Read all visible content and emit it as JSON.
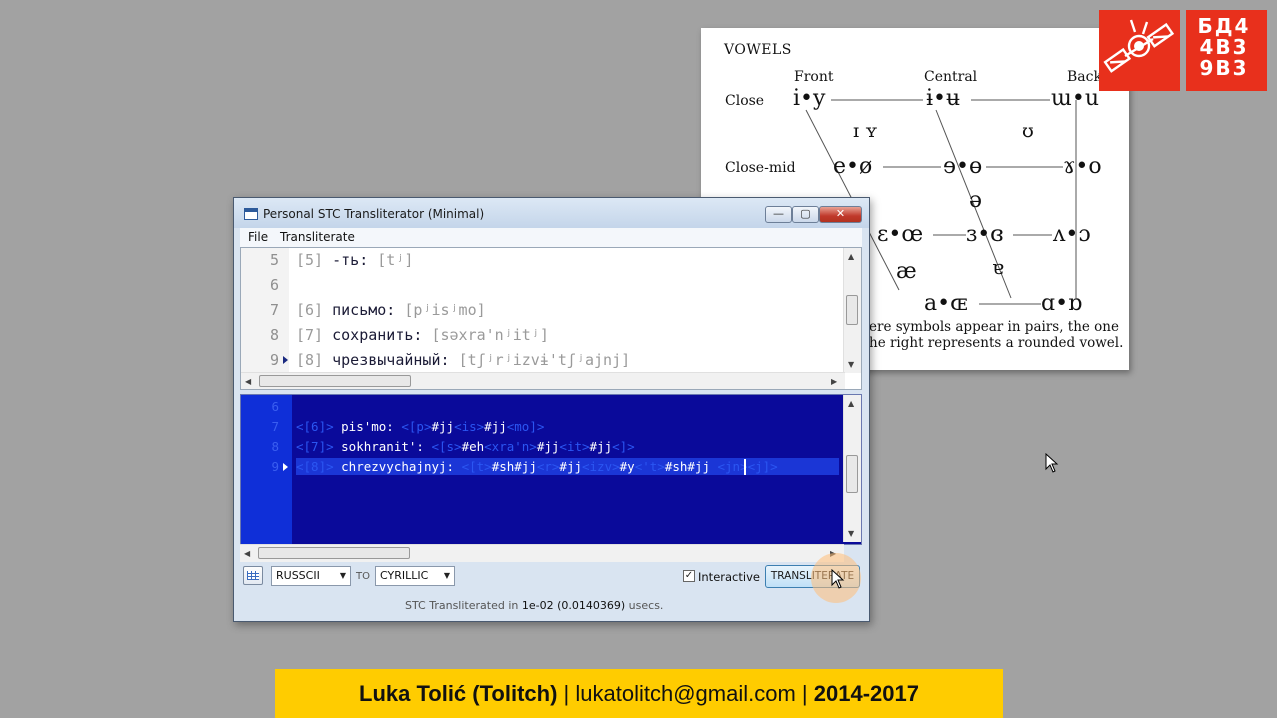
{
  "ipa_chart": {
    "heading": "VOWELS",
    "columns": {
      "front": "Front",
      "central": "Central",
      "back": "Back"
    },
    "rows": {
      "close": "Close",
      "close_mid": "Close-mid"
    },
    "symbols": {
      "close_front": "i•y",
      "close_central": "ɨ•ʉ",
      "close_back": "ɯ•u",
      "near_close_front": "ɪ ʏ",
      "near_close_back": "ʊ",
      "close_mid_front": "e•ø",
      "close_mid_central": "ɘ•ɵ",
      "close_mid_back": "ɤ•o",
      "mid_central": "ə",
      "open_mid_front": "ɛ•œ",
      "open_mid_central": "ɜ•ɞ",
      "open_mid_back": "ʌ•ɔ",
      "near_open_front": "æ",
      "near_open_central": "ɐ",
      "open_front": "a•ɶ",
      "open_back": "ɑ•ɒ"
    },
    "note_line1": "ere symbols appear in pairs, the one",
    "note_line2": "he right represents a rounded vowel."
  },
  "logo": {
    "glyphs_line1": "БД4",
    "glyphs_line2": "4В3",
    "glyphs_line3": "9В3",
    "color": "#e8301c"
  },
  "window": {
    "title": "Personal STC Transliterator (Minimal)",
    "controls": {
      "minimize": "—",
      "maximize": "▢",
      "close": "✕"
    },
    "menu": {
      "file": "File",
      "transliterate": "Transliterate"
    },
    "input_lines": [
      {
        "num": "5",
        "tag": "[5]",
        "word": "-ть:",
        "ipa": "[tʲ]"
      },
      {
        "num": "6",
        "tag": "",
        "word": "",
        "ipa": ""
      },
      {
        "num": "7",
        "tag": "[6]",
        "word": "письмо:",
        "ipa": "[pʲisʲmo]"
      },
      {
        "num": "8",
        "tag": "[7]",
        "word": "сохранить:",
        "ipa": "[səxra'nʲitʲ]"
      },
      {
        "num": "9",
        "tag": "[8]",
        "word": "чрезвычайный:",
        "ipa": "[tʃʲrʲizvɨ'tʃʲajnj]"
      }
    ],
    "output_lines": [
      {
        "num": "6",
        "segments": []
      },
      {
        "num": "7",
        "segments": [
          {
            "c": "b",
            "t": "<[6]> "
          },
          {
            "c": "w",
            "t": "pis'mo: "
          },
          {
            "c": "b",
            "t": "<[p>"
          },
          {
            "c": "w",
            "t": "#jj"
          },
          {
            "c": "b",
            "t": "<is>"
          },
          {
            "c": "w",
            "t": "#jj"
          },
          {
            "c": "b",
            "t": "<mo]>"
          }
        ]
      },
      {
        "num": "8",
        "segments": [
          {
            "c": "b",
            "t": "<[7]> "
          },
          {
            "c": "w",
            "t": "sokhranit': "
          },
          {
            "c": "b",
            "t": "<[s>"
          },
          {
            "c": "w",
            "t": "#eh"
          },
          {
            "c": "b",
            "t": "<xra'n>"
          },
          {
            "c": "w",
            "t": "#jj"
          },
          {
            "c": "b",
            "t": "<it>"
          },
          {
            "c": "w",
            "t": "#jj"
          },
          {
            "c": "b",
            "t": "<]>"
          }
        ]
      },
      {
        "num": "9",
        "segments": [
          {
            "c": "b",
            "t": "<[8]> "
          },
          {
            "c": "w",
            "t": "chrezvychajnyj: "
          },
          {
            "c": "b",
            "t": "<[t>"
          },
          {
            "c": "w",
            "t": "#sh#jj"
          },
          {
            "c": "b",
            "t": "<r>"
          },
          {
            "c": "w",
            "t": "#jj"
          },
          {
            "c": "b",
            "t": "<izv>"
          },
          {
            "c": "w",
            "t": "#y"
          },
          {
            "c": "b",
            "t": "<'t>"
          },
          {
            "c": "w",
            "t": "#sh#jj"
          },
          {
            "c": "b",
            "t": " <jn><j]>"
          }
        ]
      }
    ],
    "from_encoding": "RUSSCII",
    "to_label": "TO",
    "to_encoding": "CYRILLIC",
    "interactive_label": "Interactive",
    "interactive_checked": true,
    "transliterate_button": "TRANSLITERATE",
    "status": {
      "prefix": "STC Transliterated in",
      "value": "1e-02",
      "detail": "(0.0140369)",
      "suffix": "usecs."
    }
  },
  "footer": {
    "name": "Luka Tolić (Tolitch)",
    "separator": "|",
    "email": "lukatolitch@gmail.com",
    "years": "2014-2017"
  }
}
